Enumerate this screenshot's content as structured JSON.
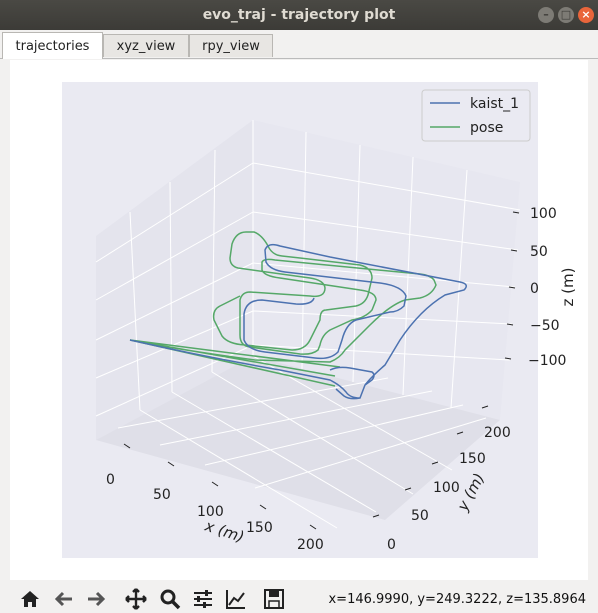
{
  "window": {
    "title": "evo_traj - trajectory plot"
  },
  "tabs": [
    {
      "label": "trajectories",
      "active": true
    },
    {
      "label": "xyz_view",
      "active": false
    },
    {
      "label": "rpy_view",
      "active": false
    }
  ],
  "chart_data": {
    "type": "line",
    "projection": "3d",
    "series": [
      {
        "name": "kaist_1",
        "color": "#4c72b0"
      },
      {
        "name": "pose",
        "color": "#55a868"
      }
    ],
    "x_axis": {
      "label": "x (m)",
      "ticks": [
        "0",
        "50",
        "100",
        "150",
        "200"
      ]
    },
    "y_axis": {
      "label": "y (m)",
      "ticks": [
        "0",
        "50",
        "100",
        "150",
        "200"
      ]
    },
    "z_axis": {
      "label": "z (m)",
      "ticks": [
        "100",
        "50",
        "0",
        "−50",
        "−100"
      ]
    },
    "grid": true,
    "legend_position": "top-right",
    "background": "#eaeaf2"
  },
  "toolbar": {
    "buttons": [
      "home-icon",
      "back-icon",
      "forward-icon",
      "pan-icon",
      "zoom-icon",
      "configure-subplots-icon",
      "edit-axis-icon",
      "save-icon"
    ],
    "coordinates": "x=146.9990, y=249.3222, z=135.8964"
  }
}
